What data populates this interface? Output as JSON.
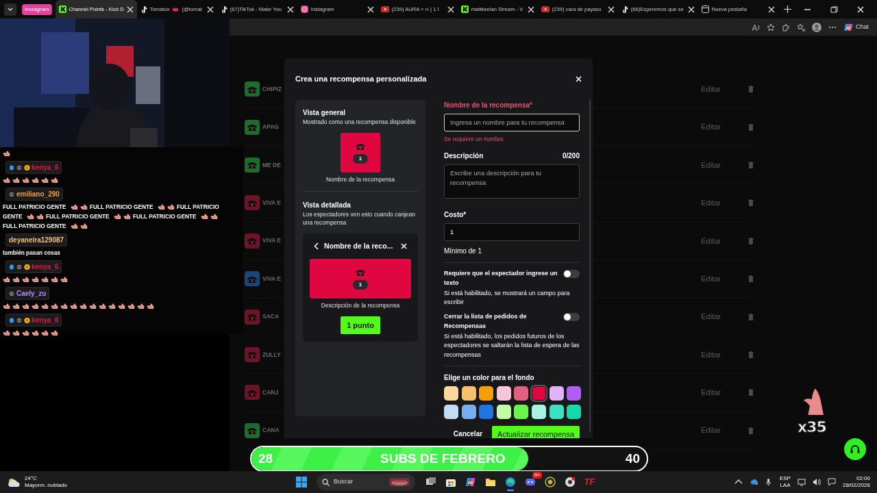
{
  "browser": {
    "tab_group": "Instagram",
    "tabs": [
      {
        "label": "Channel Points - Kick D",
        "kind": "kick",
        "selected": true
      },
      {
        "label": "Tomatox",
        "label_after_icon": "(@tomat",
        "kind": "tiktok",
        "selected": false
      },
      {
        "label": "(67)TikTok - Make You",
        "kind": "tiktok",
        "selected": false
      },
      {
        "label": "Instagram",
        "kind": "instagram",
        "selected": false
      },
      {
        "label": "(239) AURA = ∞ | 1 I",
        "kind": "youtube",
        "selected": false
      },
      {
        "label": "mattkeelan Stream - V",
        "kind": "kick",
        "selected": false
      },
      {
        "label": "(239) cara de payaso",
        "kind": "youtube",
        "selected": false
      },
      {
        "label": "(66)Esperemos que se",
        "kind": "tiktok",
        "selected": false
      },
      {
        "label": "Nueva pestaña",
        "kind": "newtab",
        "selected": false
      }
    ],
    "chat_button": "Chat"
  },
  "chat": {
    "messages": [
      {
        "parts": [
          {
            "kind": "emote"
          }
        ]
      },
      {
        "user": "kenya_6",
        "color": "#e3173f",
        "badges": [
          {
            "kind": "gem"
          },
          {
            "kind": "mod"
          },
          {
            "kind": "sub"
          }
        ],
        "parts": [
          {
            "kind": "emote"
          },
          {
            "kind": "emote"
          },
          {
            "kind": "emote"
          },
          {
            "kind": "emote"
          },
          {
            "kind": "emote"
          },
          {
            "kind": "emote"
          }
        ]
      },
      {
        "user": "emiliano_290",
        "color": "#f0a024",
        "badges": [
          {
            "kind": "mod"
          }
        ],
        "parts": [
          {
            "kind": "text",
            "text": "FULL PATRICIO GENTE"
          },
          {
            "kind": "emote"
          },
          {
            "kind": "emote"
          },
          {
            "kind": "text",
            "text": "FULL PATRICIO GENTE"
          },
          {
            "kind": "emote"
          },
          {
            "kind": "emote"
          },
          {
            "kind": "text",
            "text": "FULL PATRICIO"
          },
          {
            "kind": "text",
            "text": "GENTE"
          },
          {
            "kind": "emote"
          },
          {
            "kind": "emote"
          },
          {
            "kind": "text",
            "text": "FULL PATRICIO GENTE"
          },
          {
            "kind": "emote"
          },
          {
            "kind": "emote"
          },
          {
            "kind": "text",
            "text": "FULL PATRICIO GENTE"
          },
          {
            "kind": "emote"
          },
          {
            "kind": "emote"
          },
          {
            "kind": "text",
            "text": "FULL PATRICIO GENTE"
          },
          {
            "kind": "emote"
          },
          {
            "kind": "emote"
          }
        ]
      },
      {
        "user": "deyaneira129087",
        "color": "#f2c36b",
        "parts": [
          {
            "kind": "text",
            "text": "también pasan cosas"
          }
        ]
      },
      {
        "user": "kenya_6",
        "color": "#e3173f",
        "badges": [
          {
            "kind": "gem"
          },
          {
            "kind": "mod"
          },
          {
            "kind": "sub"
          }
        ],
        "parts": [
          {
            "kind": "emote"
          },
          {
            "kind": "emote"
          },
          {
            "kind": "emote"
          },
          {
            "kind": "emote"
          },
          {
            "kind": "emote"
          },
          {
            "kind": "emote"
          },
          {
            "kind": "emote"
          }
        ]
      },
      {
        "user": "Caely_zu",
        "color": "#b48cff",
        "badges": [
          {
            "kind": "mod"
          }
        ],
        "parts": [
          {
            "kind": "emote"
          },
          {
            "kind": "emote"
          },
          {
            "kind": "emote"
          },
          {
            "kind": "emote"
          },
          {
            "kind": "emote"
          },
          {
            "kind": "emote"
          },
          {
            "kind": "emote"
          },
          {
            "kind": "emote"
          },
          {
            "kind": "emote"
          },
          {
            "kind": "emote"
          },
          {
            "kind": "emote"
          },
          {
            "kind": "emote"
          },
          {
            "kind": "emote"
          },
          {
            "kind": "emote"
          },
          {
            "kind": "emote"
          },
          {
            "kind": "emote"
          }
        ]
      },
      {
        "user": "kenya_6",
        "color": "#e3173f",
        "badges": [
          {
            "kind": "gem"
          },
          {
            "kind": "mod"
          },
          {
            "kind": "sub"
          }
        ],
        "parts": [
          {
            "kind": "emote"
          },
          {
            "kind": "emote"
          },
          {
            "kind": "emote"
          },
          {
            "kind": "emote"
          },
          {
            "kind": "emote"
          },
          {
            "kind": "emote"
          }
        ]
      }
    ]
  },
  "rewards": [
    {
      "name": "CHIPIZ",
      "color": "#1e6b2e",
      "action": "Editar"
    },
    {
      "name": "APAG",
      "color": "#1e6b2e",
      "action": "Editar"
    },
    {
      "name": "ME DE",
      "color": "#1e6b2e",
      "action": "Editar"
    },
    {
      "name": "VIVA E",
      "color": "#6e1428",
      "action": "Editar"
    },
    {
      "name": "VIVA E",
      "color": "#6e1428",
      "action": "Editar"
    },
    {
      "name": "VIVA E",
      "color": "#1a4577",
      "action": "Editar"
    },
    {
      "name": "SACA",
      "color": "#6e1428",
      "action": "Editar"
    },
    {
      "name": "ZULLY",
      "color": "#6e1428",
      "action": "Editar"
    },
    {
      "name": "CANJ",
      "color": "#6e1428",
      "action": "Editar"
    },
    {
      "name": "CANA",
      "color": "#1e6b2e",
      "action": "Editar"
    }
  ],
  "modal": {
    "title": "Crea una recompensa personalizada",
    "overview": {
      "heading": "Vista general",
      "caption": "Mostrado como una recompensa disponible",
      "cost": "1",
      "name": "Nombre de la recompensa"
    },
    "detail": {
      "heading": "Vista detallada",
      "caption": "Los espectadores ven esto cuando canjean una recompensa",
      "title": "Nombre de la reco...",
      "cost": "1",
      "description": "Descripción de la recompensa",
      "button": "1 punto"
    },
    "name_field": {
      "label": "Nombre de la recompensa*",
      "placeholder": "Ingresa un nombre para tu recompensa",
      "invalid": true,
      "error": "Se requiere un nombre"
    },
    "description_field": {
      "label": "Descripción",
      "counter": "0/200",
      "placeholder": "Escribe una descripción para tu recompensa"
    },
    "cost_field": {
      "label": "Costo*",
      "value": "1",
      "hint": "Mínimo de 1"
    },
    "toggles": [
      {
        "label": "Requiere que el espectador ingrese un texto",
        "description": "Si está habilitado, se mostrará un campo para escribir",
        "on": false
      },
      {
        "label": "Cerrar la lista de pedidos de Recompensas",
        "description": "Si está habilitado, los pedidos futuros de los espectadores se saltarán la lista de espera de las recompensas",
        "on": false
      }
    ],
    "color_picker": {
      "label": "Elige un color para el fondo",
      "swatches": [
        {
          "color": "#fcd79b",
          "selected": false
        },
        {
          "color": "#f6c16a",
          "selected": false
        },
        {
          "color": "#f59e0b",
          "selected": false
        },
        {
          "color": "#f8c6d6",
          "selected": false
        },
        {
          "color": "#e0607e",
          "selected": false
        },
        {
          "color": "#e0063f",
          "selected": true
        },
        {
          "color": "#e0b2fb",
          "selected": false
        },
        {
          "color": "#b15cf2",
          "selected": false
        },
        {
          "color": "#c2dcf7",
          "selected": false
        },
        {
          "color": "#79aeee",
          "selected": false
        },
        {
          "color": "#1e74e0",
          "selected": false
        },
        {
          "color": "#c3fca7",
          "selected": false
        },
        {
          "color": "#6bf54a",
          "selected": false
        },
        {
          "color": "#a6f4e4",
          "selected": false
        },
        {
          "color": "#3fe0bf",
          "selected": false
        },
        {
          "color": "#17d8a8",
          "selected": false
        }
      ]
    },
    "cancel": "Cancelar",
    "submit": "Actualizar recompensa"
  },
  "goal_bar": {
    "current": "28",
    "title": "SUBS DE FEBRERO",
    "target": "40",
    "level": 0.7
  },
  "sticker": {
    "count": "x35"
  },
  "taskbar": {
    "weather": {
      "temperature": "24°C",
      "condition": "Mayorm. nublado"
    },
    "search": {
      "placeholder": "Buscar"
    },
    "apps": [
      {
        "kind": "taskview",
        "active": false
      },
      {
        "kind": "store",
        "active": false
      },
      {
        "kind": "copilot",
        "active": false
      },
      {
        "kind": "files",
        "active": false
      },
      {
        "kind": "edge",
        "active": true
      },
      {
        "kind": "discord",
        "active": false,
        "badge": "9+"
      },
      {
        "kind": "circle",
        "active": false
      },
      {
        "kind": "chrome",
        "active": false
      },
      {
        "kind": "text",
        "active": false,
        "label": "TF"
      }
    ],
    "tray": {
      "language": "ESP",
      "layout": "LAA",
      "time": "02:00",
      "date": "28/02/2026"
    }
  }
}
